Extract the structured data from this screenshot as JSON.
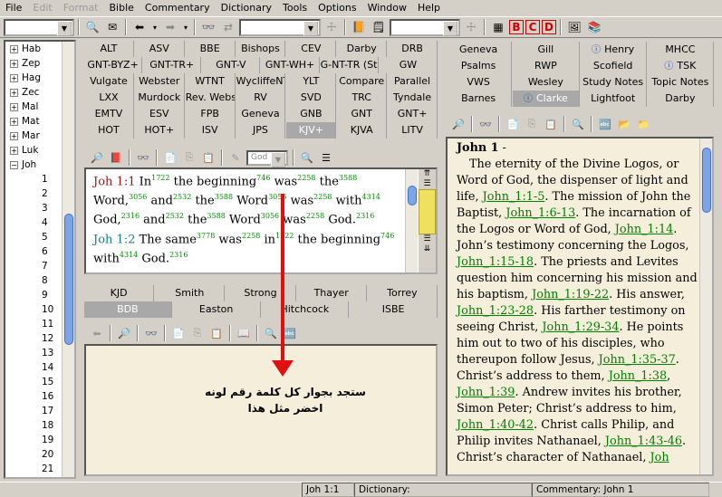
{
  "menu": [
    "File",
    "Edit",
    "Format",
    "Bible",
    "Commentary",
    "Dictionary",
    "Tools",
    "Options",
    "Window",
    "Help"
  ],
  "menu_disabled": [
    "Edit",
    "Format"
  ],
  "tree": {
    "books": [
      "Hab",
      "Zep",
      "Hag",
      "Zec",
      "Mal",
      "Mat",
      "Mar",
      "Luk",
      "Joh"
    ],
    "open_book": "Joh",
    "chapters": [
      "1",
      "2",
      "3",
      "4",
      "5",
      "6",
      "7",
      "8",
      "9",
      "10",
      "11",
      "12",
      "13",
      "14",
      "15",
      "16",
      "17",
      "18",
      "19",
      "20",
      "21"
    ]
  },
  "bible_tabs": [
    [
      "ALT",
      "ASV",
      "BBE",
      "Bishops",
      "CEV",
      "Darby",
      "DRB"
    ],
    [
      "GNT-BYZ+",
      "GNT-TR+",
      "GNT-V",
      "GNT-WH+",
      "G-NT-TR (Steph)+",
      "GW"
    ],
    [
      "Vulgate",
      "Webster",
      "WTNT",
      "WycliffeNT",
      "YLT",
      "Compare",
      "Parallel"
    ],
    [
      "LXX",
      "Murdock",
      "Rev. Webster+",
      "RV",
      "SVD",
      "TRC",
      "Tyndale"
    ],
    [
      "EMTV",
      "ESV",
      "FPB",
      "Geneva",
      "GNB",
      "GNT",
      "GNT+"
    ],
    [
      "HOT",
      "HOT+",
      "ISV",
      "JPS",
      "KJV+",
      "KJVA",
      "LITV"
    ]
  ],
  "bible_selected": "KJV+",
  "bible_toolbar": {
    "combo_value": "God"
  },
  "verses": [
    {
      "ref": "Joh 1:1",
      "parts": [
        [
          "In",
          "1722"
        ],
        [
          "the beginning",
          "746"
        ],
        [
          "was",
          "2258"
        ],
        [
          "the",
          "3588"
        ],
        [
          "Word,",
          "3056"
        ],
        [
          "and",
          "2532"
        ],
        [
          "the",
          "3588"
        ],
        [
          "Word",
          "3056"
        ],
        [
          "was",
          "2258"
        ],
        [
          "with",
          "4314"
        ],
        [
          "God,",
          "2316"
        ],
        [
          "and",
          "2532"
        ],
        [
          "the",
          "3588"
        ],
        [
          "Word",
          "3056"
        ],
        [
          "was",
          "2258"
        ],
        [
          "God.",
          "2316"
        ]
      ]
    },
    {
      "ref": "Joh 1:2",
      "parts": [
        [
          "The same",
          "3778"
        ],
        [
          "was",
          "2258"
        ],
        [
          "in",
          "1722"
        ],
        [
          "the beginning",
          "746"
        ],
        [
          "with",
          "4314"
        ],
        [
          "God.",
          "2316"
        ]
      ]
    }
  ],
  "dict_tabs": [
    [
      "KJD",
      "Smith",
      "Strong",
      "Thayer",
      "Torrey"
    ],
    [
      "BDB",
      "Easton",
      "Hitchcock",
      "ISBE"
    ]
  ],
  "dict_selected": "BDB",
  "annotation": {
    "line1": "ستجد بجوار كل كلمة رقم لونه",
    "line2": "اخضر مثل هذا"
  },
  "comm_tabs": [
    [
      "Geneva",
      "Gill",
      "Henry",
      "MHCC"
    ],
    [
      "Psalms",
      "RWP",
      "Scofield",
      "TSK"
    ],
    [
      "VWS",
      "Wesley",
      "Study Notes",
      "Topic Notes"
    ],
    [
      "Barnes",
      "Clarke",
      "Lightfoot",
      "Darby"
    ]
  ],
  "comm_selected": "Clarke",
  "commentary": {
    "title": "John 1",
    "dash": " -",
    "segments": [
      [
        "t",
        "The eternity of the Divine Logos, or Word of God, the dispenser of light and life, "
      ],
      [
        "l",
        "John_1:1-5"
      ],
      [
        "t",
        ". The mission of John the Baptist, "
      ],
      [
        "l",
        "John_1:6-13"
      ],
      [
        "t",
        ". The incarnation of the Logos or Word of God, "
      ],
      [
        "l",
        "John_1:14"
      ],
      [
        "t",
        ". John’s testimony concerning the Logos, "
      ],
      [
        "l",
        "John_1:15-18"
      ],
      [
        "t",
        ". The priests and Levites question him concerning his mission and his baptism, "
      ],
      [
        "l",
        "John_1:19-22"
      ],
      [
        "t",
        ". His answer, "
      ],
      [
        "l",
        "John_1:23-28"
      ],
      [
        "t",
        ". His farther testimony on seeing Christ, "
      ],
      [
        "l",
        "John_1:29-34"
      ],
      [
        "t",
        ". He points him out to two of his disciples, who thereupon follow Jesus, "
      ],
      [
        "l",
        "John_1:35-37"
      ],
      [
        "t",
        ". Christ’s address to them, "
      ],
      [
        "l",
        "John_1:38"
      ],
      [
        "t",
        ", "
      ],
      [
        "l",
        "John_1:39"
      ],
      [
        "t",
        ". Andrew invites his brother, Simon Peter; Christ’s address to him, "
      ],
      [
        "l",
        "John_1:40-42"
      ],
      [
        "t",
        ". Christ calls Philip, and Philip invites Nathanael, "
      ],
      [
        "l",
        "John_1:43-46"
      ],
      [
        "t",
        ". Christ’s character of Nathanael, "
      ],
      [
        "l",
        "Joh"
      ]
    ]
  },
  "status": {
    "verse": "Joh 1:1",
    "dictionary": "Dictionary:",
    "commentary": "Commentary: John 1"
  },
  "colors": {
    "strong_number": "#009000",
    "verse_ref": "#8b1a1a",
    "link": "#008000",
    "arrow": "#e01010"
  }
}
